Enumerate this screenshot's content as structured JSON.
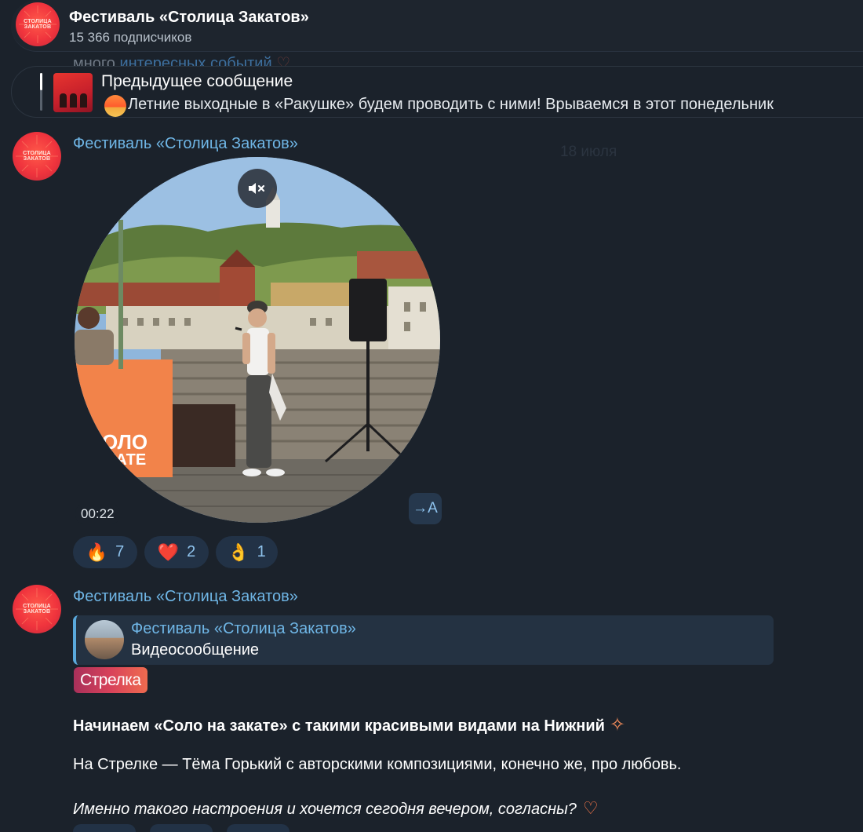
{
  "channel": {
    "name": "Фестиваль «Столица Закатов»",
    "subscribers": "15 366 подписчиков"
  },
  "avatar": {
    "logo_line1": "СТОЛИЦА",
    "logo_line2": "ЗАКАТОВ"
  },
  "peek": {
    "text_plain": "много ",
    "text_link": "интересных событий"
  },
  "previous_message": {
    "title": "Предыдущее сообщение",
    "text": "Летние выходные в «Ракушке» будем проводить с ними!  Врываемся в этот понедельник"
  },
  "message1": {
    "sender": "Фестиваль «Столица Закатов»",
    "date": "18 июля",
    "duration": "00:22",
    "translate_label": "→A",
    "reactions": [
      {
        "emoji": "🔥",
        "count": "7"
      },
      {
        "emoji": "❤️",
        "count": "2"
      },
      {
        "emoji": "👌",
        "count": "1"
      }
    ]
  },
  "message2": {
    "sender": "Фестиваль «Столица Закатов»",
    "reply": {
      "author": "Фестиваль «Столица Закатов»",
      "text": "Видеосообщение"
    },
    "tag": "Стрелка",
    "line1": "Начинаем «Соло на закате» с такими красивыми видами на Нижний",
    "line2": "На Стрелке — Тёма Горький с авторскими композициями, конечно же, про любовь.",
    "line3": "Именно такого настроения и хочется сегодня вечером, согласны?"
  },
  "colors": {
    "background": "#1b222b",
    "accent_link": "#6fb6e6",
    "reaction_bg": "#223246",
    "brand_red": "#f0343d"
  },
  "icons": [
    "mute-icon",
    "sun-emoji-icon",
    "sparkle-icon",
    "heart-outline-icon"
  ]
}
